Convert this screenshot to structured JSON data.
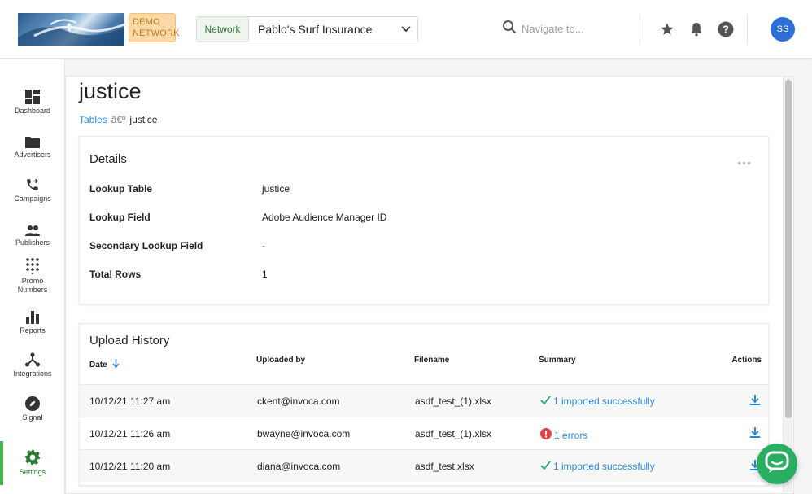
{
  "header": {
    "demo_badge": "DEMO NETWORK",
    "network_tag": "Network",
    "network_value": "Pablo's Surf Insurance",
    "search_placeholder": "Navigate to...",
    "avatar_initials": "SS"
  },
  "sidebar": {
    "items": [
      {
        "label": "Dashboard",
        "icon": "dashboard-icon"
      },
      {
        "label": "Advertisers",
        "icon": "folder-icon"
      },
      {
        "label": "Campaigns",
        "icon": "phone-forward-icon"
      },
      {
        "label": "Publishers",
        "icon": "people-icon"
      },
      {
        "label": "Promo Numbers",
        "icon": "dialpad-icon"
      },
      {
        "label": "Reports",
        "icon": "bar-chart-icon"
      },
      {
        "label": "Integrations",
        "icon": "integrations-icon"
      },
      {
        "label": "Signal",
        "icon": "compass-icon"
      },
      {
        "label": "Settings",
        "icon": "gear-icon",
        "active": true
      }
    ]
  },
  "page": {
    "title": "justice",
    "breadcrumb": {
      "link": "Tables",
      "separator": "â€º",
      "current": "justice"
    }
  },
  "details": {
    "title": "Details",
    "rows": [
      {
        "label": "Lookup Table",
        "value": "justice"
      },
      {
        "label": "Lookup Field",
        "value": "Adobe Audience Manager ID"
      },
      {
        "label": "Secondary Lookup Field",
        "value": "-"
      },
      {
        "label": "Total Rows",
        "value": "1"
      }
    ]
  },
  "upload_history": {
    "title": "Upload History",
    "columns": {
      "date": "Date",
      "uploaded_by": "Uploaded by",
      "filename": "Filename",
      "summary": "Summary",
      "actions": "Actions"
    },
    "rows": [
      {
        "date": "10/12/21 11:27 am",
        "uploaded_by": "ckent@invoca.com",
        "filename": "asdf_test_(1).xlsx",
        "summary": "1 imported successfully",
        "status": "success"
      },
      {
        "date": "10/12/21 11:26 am",
        "uploaded_by": "bwayne@invoca.com",
        "filename": "asdf_test_(1).xlsx",
        "summary": "1 errors",
        "status": "error"
      },
      {
        "date": "10/12/21 11:20 am",
        "uploaded_by": "diana@invoca.com",
        "filename": "asdf_test.xlsx",
        "summary": "1 imported successfully",
        "status": "success"
      }
    ]
  },
  "colors": {
    "accent": "#2d8ad6",
    "brand_green": "#27ae60",
    "error": "#e04646",
    "avatar": "#2d6fd6"
  }
}
